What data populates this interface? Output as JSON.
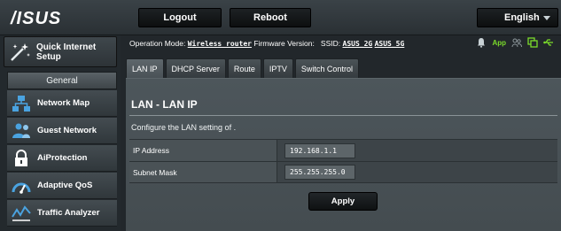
{
  "brand": {
    "logo_text": "/ISUS"
  },
  "header": {
    "logout_label": "Logout",
    "reboot_label": "Reboot",
    "language": "English"
  },
  "sidebar": {
    "quick_setup_label": "Quick Internet Setup",
    "section_label": "General",
    "items": [
      {
        "label": "Network Map",
        "icon": "network-map-icon"
      },
      {
        "label": "Guest Network",
        "icon": "guest-network-icon"
      },
      {
        "label": "AiProtection",
        "icon": "lock-icon"
      },
      {
        "label": "Adaptive QoS",
        "icon": "speedometer-icon"
      },
      {
        "label": "Traffic Analyzer",
        "icon": "traffic-analyzer-icon"
      }
    ]
  },
  "status": {
    "op_mode_label": "Operation Mode:",
    "op_mode_value": "Wireless router",
    "firmware_label": "Firmware Version:",
    "ssid_label": "SSID:",
    "ssid_1": "ASUS_2G",
    "ssid_2": "ASUS_5G",
    "app_label": "App"
  },
  "tabs": [
    {
      "label": "LAN IP",
      "active": true
    },
    {
      "label": "DHCP Server",
      "active": false
    },
    {
      "label": "Route",
      "active": false
    },
    {
      "label": "IPTV",
      "active": false
    },
    {
      "label": "Switch Control",
      "active": false
    }
  ],
  "content": {
    "title": "LAN - LAN IP",
    "description": "Configure the LAN setting of .",
    "fields": [
      {
        "label": "IP Address",
        "value": "192.168.1.1"
      },
      {
        "label": "Subnet Mask",
        "value": "255.255.255.0"
      }
    ],
    "apply_label": "Apply"
  },
  "colors": {
    "accent_green": "#7bdb2b",
    "panel_bg": "#4d565b",
    "topbar_bg": "#2a3034"
  }
}
